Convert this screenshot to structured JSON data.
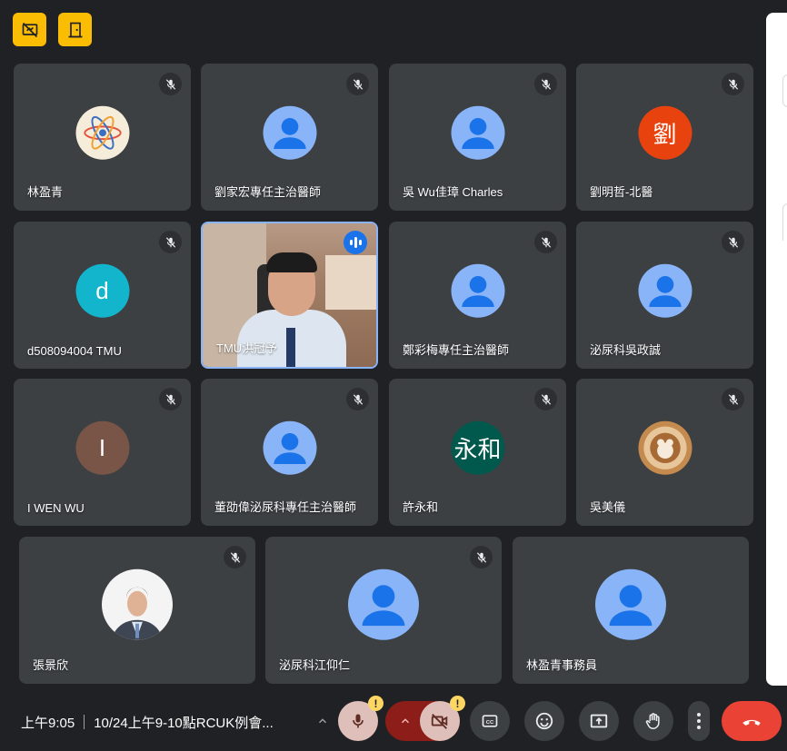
{
  "participants": [
    {
      "name": "林盈青",
      "avatar": "atom",
      "muted": true
    },
    {
      "name": "劉家宏專任主治醫師",
      "avatar": "default",
      "muted": true
    },
    {
      "name": "吳 Wu佳璋 Charles",
      "avatar": "default",
      "muted": true
    },
    {
      "name": "劉明哲-北醫",
      "avatar": "letter",
      "letter": "劉",
      "color": "#e8430e",
      "muted": true
    },
    {
      "name": "d508094004 TMU",
      "avatar": "letter",
      "letter": "d",
      "color": "#12b5cb",
      "muted": true
    },
    {
      "name": "TMU洪冠予",
      "avatar": "video",
      "speaking": true
    },
    {
      "name": "鄭彩梅專任主治醫師",
      "avatar": "default",
      "muted": true
    },
    {
      "name": "泌尿科吳政誠",
      "avatar": "default",
      "muted": true
    },
    {
      "name": "I WEN WU",
      "avatar": "letter",
      "letter": "I",
      "color": "#795548",
      "muted": true
    },
    {
      "name": "董劭偉泌尿科專任主治醫師",
      "avatar": "default",
      "muted": true
    },
    {
      "name": "許永和",
      "avatar": "letter",
      "letter": "永和",
      "color": "#00594c",
      "muted": true
    },
    {
      "name": "吳美儀",
      "avatar": "latte",
      "muted": true
    },
    {
      "name": "張景欣",
      "avatar": "photo",
      "muted": true
    },
    {
      "name": "泌尿科江仰仁",
      "avatar": "default",
      "muted": true
    },
    {
      "name": "林盈青事務員",
      "avatar": "default",
      "muted": false
    }
  ],
  "bottombar": {
    "time": "上午9:05",
    "meeting_title": "10/24上午9-10點RCUK例會..."
  },
  "alerts": {
    "mic_warning": "!",
    "camera_warning": "!"
  },
  "colors": {
    "accent": "#8ab4f8",
    "end_call": "#ea4335",
    "warning": "#fbbc04",
    "tile": "#3c4043",
    "background": "#202124"
  }
}
